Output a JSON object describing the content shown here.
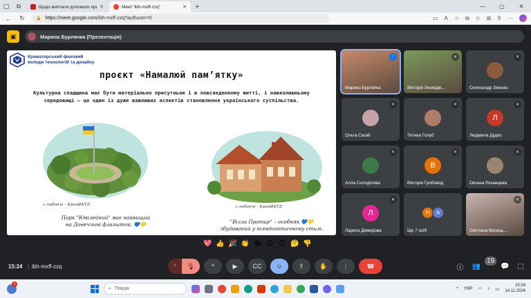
{
  "browser": {
    "tabs": [
      {
        "title": "Щодо виплати допомоги при п...",
        "fav_color": "#c5221f",
        "active": false
      },
      {
        "title": "Meet \"ibh-mxff-zzq\"",
        "fav_color": "#ea4335",
        "active": true
      }
    ],
    "close_glyph": "✕",
    "new_tab_glyph": "+",
    "url_host": "https://meet.google.com",
    "url_path": "/ibh-mxff-zzq?authuser=0"
  },
  "meet": {
    "presenter_label": "Марина Бурлачка (Презентація)",
    "meeting_time": "15:24",
    "meeting_code": "ibh-mxff-zzq",
    "people_count": "19",
    "reactions": [
      "💖",
      "👍",
      "🎉",
      "👏",
      "😂",
      "😮",
      "😢",
      "🤔",
      "👎"
    ]
  },
  "slide": {
    "college_name_line1": "Краматорський фаховий",
    "college_name_line2": "коледж технологій та дизайну",
    "title": "проєкт «Намалюй пам’ятку»",
    "lead": "Культурна спадщина має бути матеріально присутньою і в повсякденному житті, і навколишньому середовищі – це один із дуже важливих аспектів становлення українського суспільства.",
    "sig1": "з любов'ю – КрамФКТД",
    "sig2": "з любов'ю – КрамФКТД",
    "caption1_line1": "Парк \"Ювілейний\" має найвищий",
    "caption1_line2": "на Донеччині флагшток. 💙💛",
    "caption2_line1": "\"Вілла Протце\" – особняк 💙💛",
    "caption2_line2": "збудований у псевдоготичному стилі."
  },
  "participants": [
    {
      "name": "Марина Бурлачка",
      "kind": "photo",
      "color": "#c98a6a",
      "speaking": true
    },
    {
      "name": "Вікторія Леонідів...",
      "kind": "photo",
      "color": "#7a9a5a",
      "speaking": false
    },
    {
      "name": "Олександр Зіненко",
      "kind": "avatar",
      "initial": "",
      "color": "#8d5b3e",
      "speaking": false
    },
    {
      "name": "Ольга Сагай",
      "kind": "avatar",
      "initial": "",
      "color": "#c7a2a8",
      "speaking": false
    },
    {
      "name": "Тетяна Голуб",
      "kind": "avatar",
      "initial": "",
      "color": "#b07c6a",
      "speaking": false
    },
    {
      "name": "Людмила Дудко",
      "kind": "avatar",
      "initial": "Л",
      "color": "#c53929",
      "speaking": false
    },
    {
      "name": "Алла Солоділова",
      "kind": "avatar",
      "initial": "",
      "color": "#3e7a4a",
      "speaking": false
    },
    {
      "name": "Вікторія Гробовод",
      "kind": "avatar",
      "initial": "В",
      "color": "#e8710a",
      "speaking": false
    },
    {
      "name": "Оксана Рязанцева",
      "kind": "avatar",
      "initial": "",
      "color": "#9a8670",
      "speaking": false
    },
    {
      "name": "Лариса Демидова",
      "kind": "avatar",
      "initial": "Л",
      "color": "#e52592",
      "speaking": false
    },
    {
      "name": "Ще 7 осіб",
      "kind": "more",
      "initial_a": "Н",
      "initial_b": "А",
      "color_a": "#e8710a",
      "color_b": "#5e7bd8",
      "speaking": false
    },
    {
      "name": "Світлана Висиць...",
      "kind": "photo",
      "color": "#c9b5b0",
      "speaking": false
    }
  ],
  "taskbar": {
    "notif_count": "1",
    "search_placeholder": "Пошук",
    "lang": "УКР",
    "time": "15:24",
    "date": "14.11.2024"
  },
  "colors": {
    "accent": "#8ab4f8",
    "hangup": "#ea4335",
    "present": "#fbbc04"
  }
}
